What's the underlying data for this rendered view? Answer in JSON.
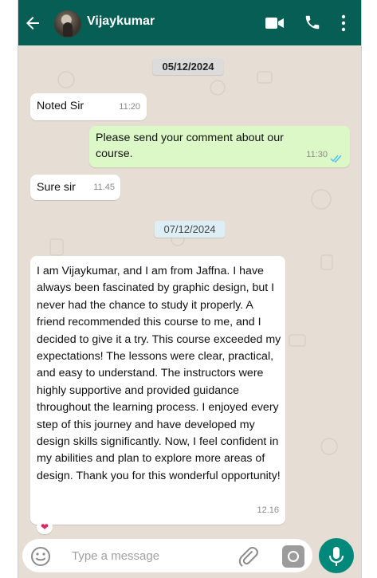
{
  "header": {
    "contact_name": "Vijaykumar",
    "icons": [
      "back-arrow-icon",
      "video-call-icon",
      "phone-icon",
      "more-vert-icon"
    ],
    "color": "#075e54"
  },
  "dates": [
    "05/12/2024",
    "07/12/2024"
  ],
  "messages": [
    {
      "direction": "in",
      "text": "Noted Sir",
      "time": "11:20"
    },
    {
      "direction": "out",
      "text": "Please send your comment about our course.",
      "time": "11:30",
      "status": "read"
    },
    {
      "direction": "in",
      "text": "Sure sir",
      "time": "11.45"
    },
    {
      "direction": "in",
      "text": "I am Vijaykumar, and I am from Jaffna. I have always been fascinated by graphic design, but I never had the chance to study it properly. A friend recommended this course to me, and I decided to give it a try. This course exceeded my expectations! The lessons were clear, practical, and easy to understand. The instructors were highly supportive and provided guidance throughout the learning process. I enjoyed every step of this journey and have developed my design skills significantly. Now, I feel confident in my abilities and plan to explore more areas of design. Thank you for this wonderful opportunity!",
      "time": "12.16",
      "reaction": "❤"
    }
  ],
  "input": {
    "placeholder": "Type a message",
    "icons": [
      "emoji-icon",
      "attach-icon",
      "camera-icon",
      "mic-icon"
    ]
  },
  "colors": {
    "outgoing_bubble": "#dcf8c6",
    "incoming_bubble": "#ffffff",
    "chat_background": "#e6ded5",
    "mic_button": "#00897b"
  }
}
